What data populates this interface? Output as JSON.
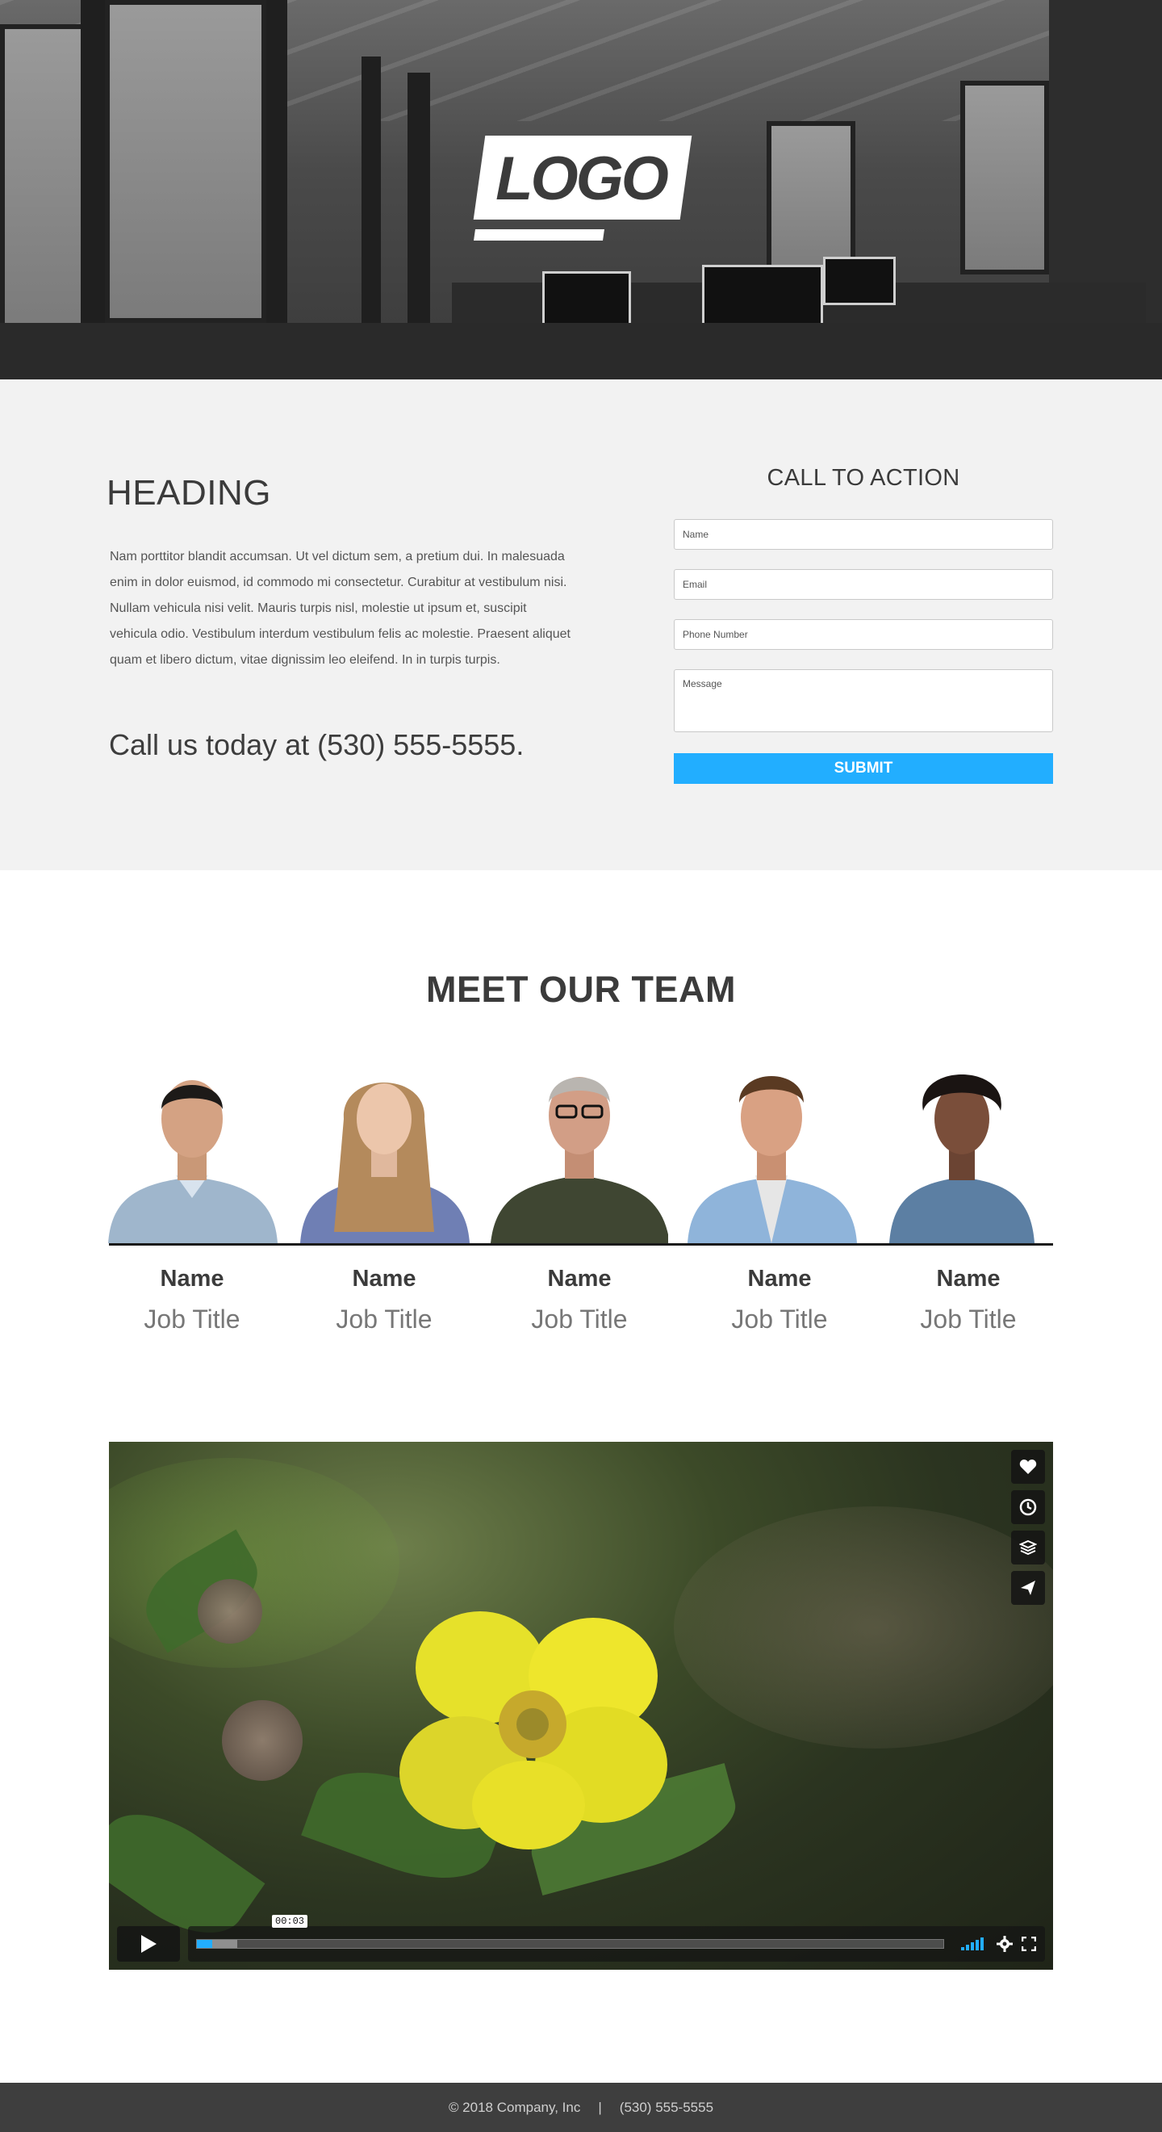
{
  "hero": {
    "logo_text": "LOGO"
  },
  "intro": {
    "heading": "HEADING",
    "paragraph": "Nam porttitor blandit accumsan. Ut vel dictum sem, a pretium dui. In malesuada enim in dolor euismod, id commodo mi consectetur. Curabitur at vestibulum nisi. Nullam vehicula nisi velit. Mauris turpis nisl, molestie ut ipsum et, suscipit vehicula odio. Vestibulum interdum vestibulum felis ac molestie. Praesent aliquet quam et libero dictum, vitae dignissim leo eleifend. In in turpis turpis.",
    "call_text": "Call us today at (530) 555-5555."
  },
  "form": {
    "title": "CALL TO ACTION",
    "name_placeholder": "Name",
    "email_placeholder": "Email",
    "phone_placeholder": "Phone Number",
    "message_placeholder": "Message",
    "submit_label": "SUBMIT",
    "accent_color": "#22aeff"
  },
  "team": {
    "title": "MEET OUR TEAM",
    "members": [
      {
        "name": "Name",
        "job_title": "Job Title"
      },
      {
        "name": "Name",
        "job_title": "Job Title"
      },
      {
        "name": "Name",
        "job_title": "Job Title"
      },
      {
        "name": "Name",
        "job_title": "Job Title"
      },
      {
        "name": "Name",
        "job_title": "Job Title"
      }
    ]
  },
  "video": {
    "time": "00:03",
    "side_buttons": [
      "heart-icon",
      "clock-icon",
      "layers-icon",
      "send-icon"
    ],
    "progress_fraction": 0.02
  },
  "footer": {
    "copyright": "© 2018 Company, Inc",
    "separator": "|",
    "phone": "(530) 555-5555",
    "background": "#3e3e3e"
  }
}
